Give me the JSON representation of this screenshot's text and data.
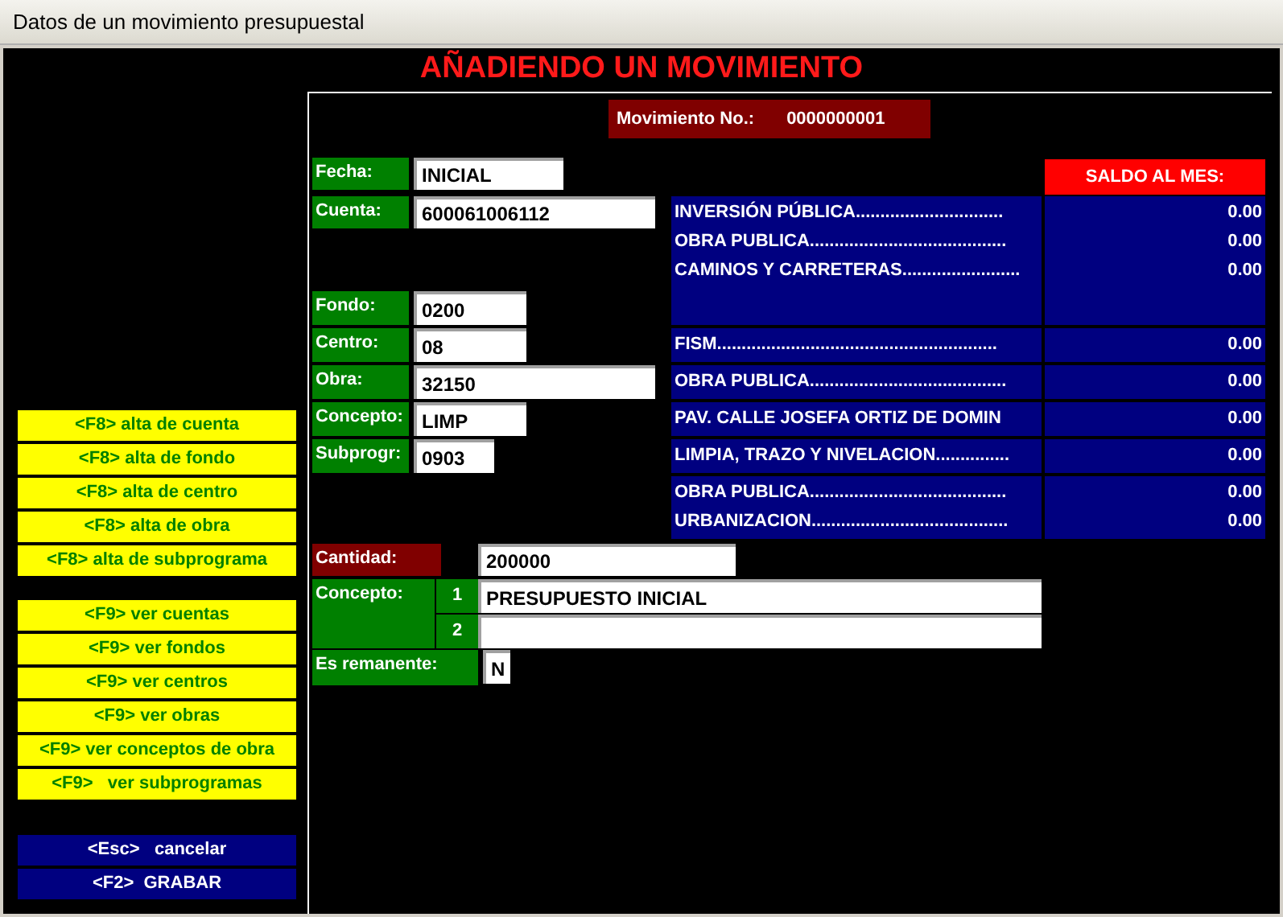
{
  "window": {
    "title": "Datos de un movimiento presupuestal"
  },
  "heading": "AÑADIENDO UN MOVIMIENTO",
  "shortcut_groups": [
    {
      "kind": "add",
      "buttons": [
        "<F8> alta de cuenta",
        "<F8> alta de fondo",
        "<F8> alta de centro",
        "<F8> alta de obra",
        "<F8> alta de subprograma"
      ]
    },
    {
      "kind": "view",
      "buttons": [
        "<F9> ver cuentas",
        "<F9> ver fondos",
        "<F9> ver centros",
        "<F9> ver obras",
        "<F9> ver conceptos de obra",
        "<F9>   ver subprogramas"
      ]
    },
    {
      "kind": "action",
      "buttons": [
        "<Esc>   cancelar",
        "<F2>  GRABAR"
      ]
    }
  ],
  "movement": {
    "label": "Movimiento No.:",
    "number": "0000000001"
  },
  "top_fields": [
    {
      "label": "Fecha:",
      "value": "INICIAL"
    },
    {
      "label": "Cuenta:",
      "value": "600061006112"
    }
  ],
  "code_fields": [
    {
      "label": "Fondo:",
      "value": "0200"
    },
    {
      "label": "Centro:",
      "value": "08"
    },
    {
      "label": "Obra:",
      "value": "32150"
    },
    {
      "label": "Concepto:",
      "value": "LIMP"
    },
    {
      "label": "Subprogr:",
      "value": "0903"
    }
  ],
  "balance": {
    "header": "SALDO AL MES:",
    "groups": [
      {
        "rows": [
          {
            "name": "INVERSIÓN PÚBLICA..............................",
            "amount": "0.00"
          },
          {
            "name": "OBRA PUBLICA........................................",
            "amount": "0.00"
          },
          {
            "name": "CAMINOS Y CARRETERAS........................",
            "amount": "0.00"
          }
        ]
      },
      {
        "rows": [
          {
            "name": "FISM.........................................................",
            "amount": "0.00"
          }
        ]
      },
      {
        "rows": [
          {
            "name": "OBRA PUBLICA........................................",
            "amount": "0.00"
          }
        ]
      },
      {
        "rows": [
          {
            "name": "PAV. CALLE JOSEFA ORTIZ DE DOMIN",
            "amount": "0.00"
          }
        ]
      },
      {
        "rows": [
          {
            "name": "LIMPIA, TRAZO Y NIVELACION...............",
            "amount": "0.00"
          }
        ]
      },
      {
        "rows": [
          {
            "name": "OBRA PUBLICA........................................",
            "amount": "0.00"
          },
          {
            "name": "URBANIZACION........................................",
            "amount": "0.00"
          }
        ]
      }
    ]
  },
  "amount": {
    "label": "Cantidad:",
    "value": "200000"
  },
  "concept": {
    "label": "Concepto:",
    "lines": [
      {
        "number": "1",
        "value": "PRESUPUESTO INICIAL"
      },
      {
        "number": "2"
      }
    ]
  },
  "remnant": {
    "label": "Es remanente:",
    "value": "N"
  }
}
